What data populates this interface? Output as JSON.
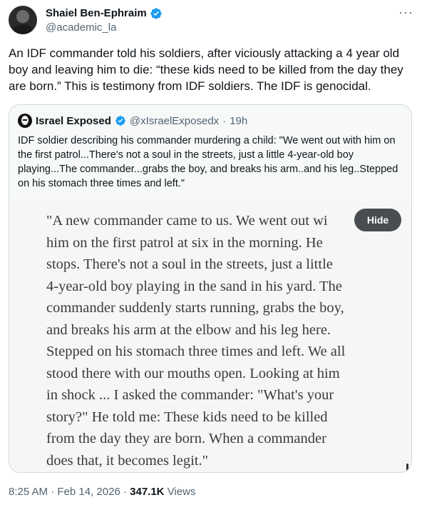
{
  "author": {
    "display_name": "Shaiel Ben-Ephraim",
    "handle": "@academic_la",
    "verified_color": "#1d9bf0"
  },
  "more_icon": "more-dots-icon",
  "tweet": {
    "text": "An IDF commander told his soldiers, after viciously attacking a 4 year old boy and leaving him to die: “these kids need to be killed from the day they are born.” This is testimony from IDF soldiers. The IDF is genocidal."
  },
  "quote": {
    "display_name": "Israel Exposed",
    "handle": "@xIsraelExposedx",
    "separator": "·",
    "time": "19h",
    "text": "IDF soldier describing his commander murdering a child: \"We went out with him on the first patrol...There's not a soul in the streets, just a little 4-year-old boy playing...The commander...grabs the boy, and breaks his arm..and his leg..Stepped on his stomach three times and left.\"",
    "media_lines": [
      "\"A new commander came to us. We went out wi",
      "him on the first patrol at six in the morning. He",
      "stops. There's not a soul in the streets, just a little",
      "4-year-old boy playing in the sand in his yard. The",
      "commander suddenly starts running, grabs the boy,",
      "and breaks his arm at the elbow and his leg here.",
      "Stepped on his stomach three times and left. We all",
      "stood there with our mouths open. Looking at him",
      "in shock ... I asked the commander: \"What's your",
      "story?\" He told me: These kids need to be killed",
      "from the day they are born. When a commander",
      "does that, it becomes legit.\""
    ],
    "hide_label": "Hide"
  },
  "footer": {
    "time": "8:25 AM",
    "dot1": "·",
    "date": "Feb 14, 2026",
    "dot2": "·",
    "views_count": "347.1K",
    "views_label": "Views"
  }
}
